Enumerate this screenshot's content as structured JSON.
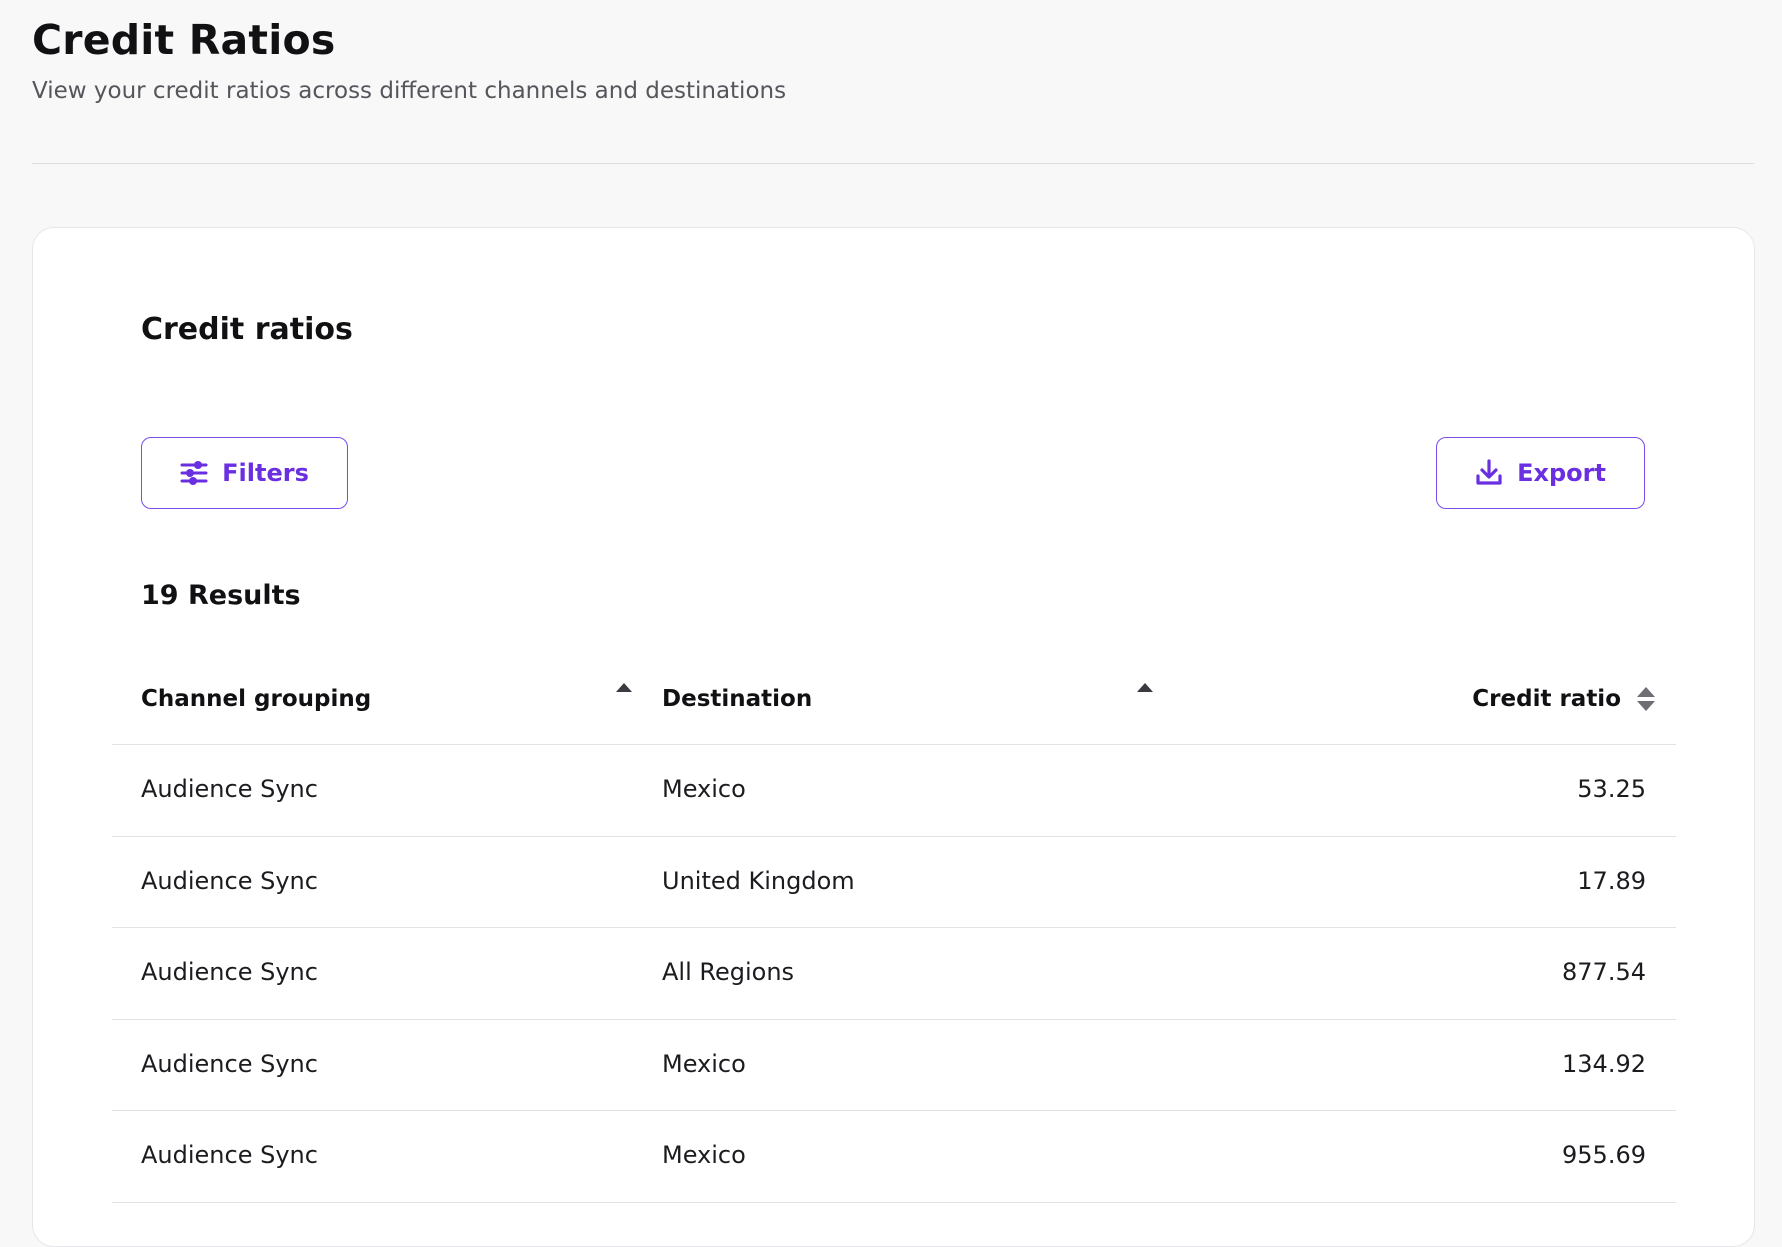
{
  "header": {
    "title": "Credit Ratios",
    "subtitle": "View your credit ratios across different channels and destinations"
  },
  "card": {
    "title": "Credit ratios",
    "filters_label": "Filters",
    "export_label": "Export",
    "results_label": "19 Results"
  },
  "table": {
    "columns": {
      "channel": "Channel grouping",
      "destination": "Destination",
      "ratio": "Credit ratio"
    },
    "rows": [
      {
        "channel": "Audience Sync",
        "destination": "Mexico",
        "ratio": "53.25"
      },
      {
        "channel": "Audience Sync",
        "destination": "United Kingdom",
        "ratio": "17.89"
      },
      {
        "channel": "Audience Sync",
        "destination": "All Regions",
        "ratio": "877.54"
      },
      {
        "channel": "Audience Sync",
        "destination": "Mexico",
        "ratio": "134.92"
      },
      {
        "channel": "Audience Sync",
        "destination": "Mexico",
        "ratio": "955.69"
      }
    ]
  },
  "icons": {
    "filters": "sliders-icon",
    "export": "download-icon",
    "sort_asc": "sort-ascending-icon",
    "sort_both": "sort-icon"
  },
  "colors": {
    "accent": "#6a2fe0",
    "accent_border": "#7b4bea",
    "page_background": "#f8f8f8",
    "card_background": "#ffffff"
  }
}
